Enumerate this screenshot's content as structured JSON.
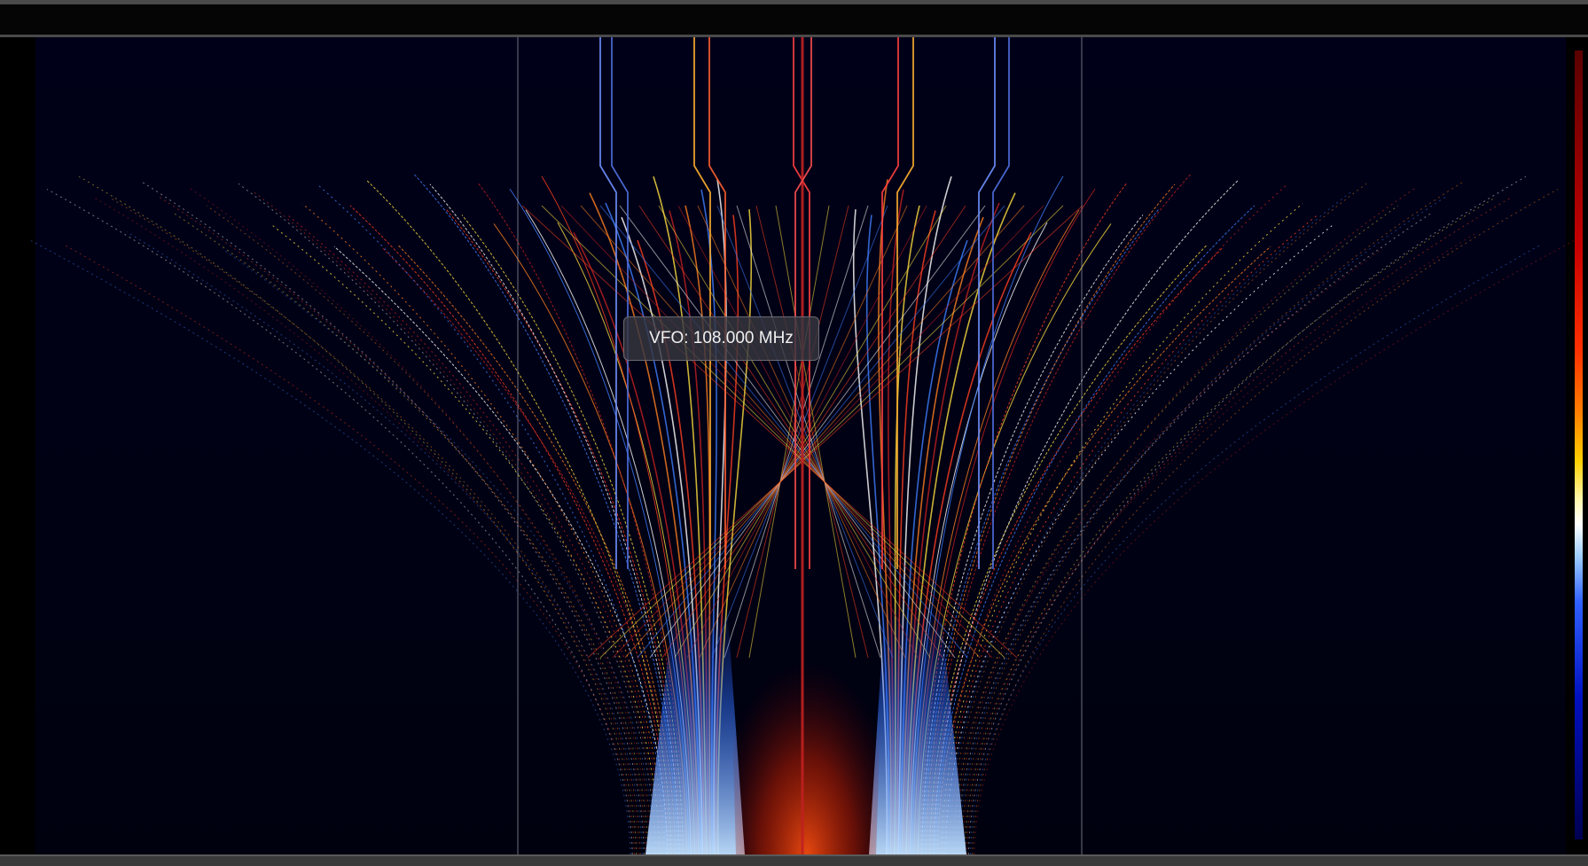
{
  "vfo": {
    "label": "VFO:",
    "frequency": "108.000",
    "unit": "MHz"
  },
  "colors": {
    "background": "#000114",
    "signal_hot": "#ff3000",
    "signal_warm": "#ffd000",
    "signal_cool": "#3060ff",
    "marker_line": "#c8c8d8"
  },
  "icons": {
    "color_scale": "color-scale-bar"
  }
}
